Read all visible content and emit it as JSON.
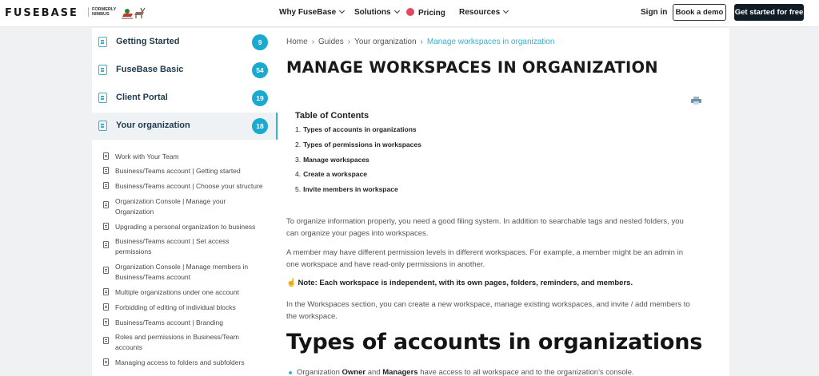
{
  "header": {
    "logo": "FUSEBASE",
    "logo_sub_1": "FORMERLY",
    "logo_sub_2": "NIMBUS",
    "nav": [
      {
        "label": "Why FuseBase"
      },
      {
        "label": "Solutions"
      },
      {
        "label": "Pricing"
      },
      {
        "label": "Resources"
      }
    ],
    "signin": "Sign in",
    "demo": "Book a demo",
    "start": "Get started for free"
  },
  "sidebar": {
    "categories": [
      {
        "label": "Getting Started",
        "count": "9"
      },
      {
        "label": "FuseBase Basic",
        "count": "54"
      },
      {
        "label": "Client Portal",
        "count": "19"
      },
      {
        "label": "Your organization",
        "count": "18",
        "active": true
      }
    ],
    "subitems": [
      "Work with Your Team",
      "Business/Teams account | Getting started",
      "Business/Teams account | Choose your structure",
      "Organization Console | Manage your Organization",
      "Upgrading a personal organization to business",
      "Business/Teams account | Set access permissions",
      "Organization Console | Manage members in Business/Teams account",
      "Multiple organizations under one account",
      "Forbidding of editing of individual blocks",
      "Business/Teams account | Branding",
      "Roles and permissions in Business/Team accounts",
      "Managing access to folders and subfolders"
    ]
  },
  "breadcrumb": [
    "Home",
    "Guides",
    "Your organization",
    "Manage workspaces in organization"
  ],
  "page_title": "MANAGE WORKSPACES IN ORGANIZATION",
  "toc": {
    "title": "Table of Contents",
    "items": [
      {
        "num": "1.",
        "text": "Types of accounts in organizations"
      },
      {
        "num": "2.",
        "text": "Types of permissions in workspaces"
      },
      {
        "num": "3.",
        "text": "Manage workspaces"
      },
      {
        "num": "4.",
        "text": "Create a workspace"
      },
      {
        "num": "5.",
        "text": "Invite members in workspace"
      }
    ]
  },
  "paragraphs": {
    "p1a": "To organize information properly, you need a good filing system. In addition to searchable tags and nested folders, you",
    "p1b": "can organize your pages into workspaces.",
    "p2a": "A member may have different permission levels in different workspaces. For example, a member might be an admin in",
    "p2b": "one workspace and have read-only permissions in another.",
    "note": "Note: Each workspace is independent, with its own pages, folders, reminders, and members.",
    "p3a": "In the Workspaces section, you can create a new workspace, manage existing workspaces, and invite / add members to",
    "p3b": "the workspace."
  },
  "section_heading": "Types of accounts in organizations",
  "bullet": {
    "pre": "Organization ",
    "b1": "Owner",
    "mid": " and ",
    "b2": "Managers",
    "post": " have access to all workspace and to the organization's console."
  },
  "colors": {
    "accent": "#1aa9cf",
    "dark_button": "#0f1d26"
  }
}
